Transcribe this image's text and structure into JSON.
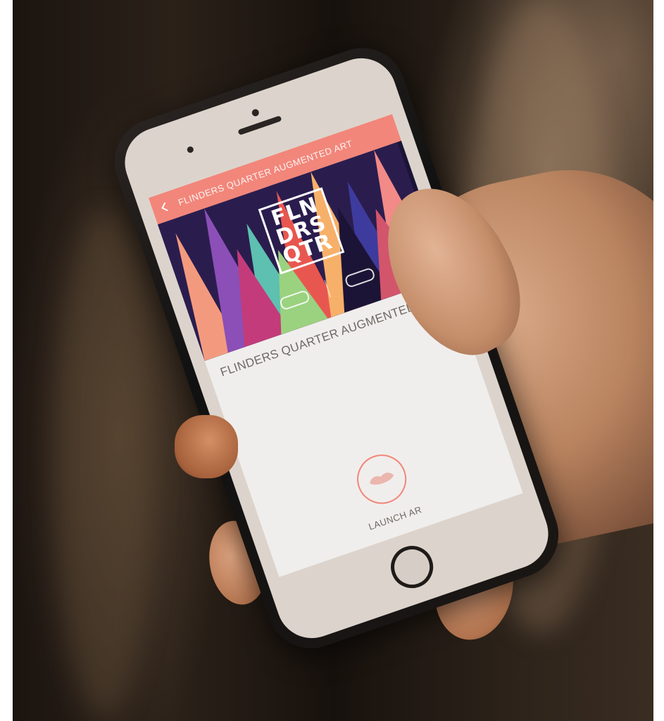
{
  "app": {
    "title": "FLINDERS QUARTER AUGMENTED ART"
  },
  "hero": {
    "logo_lines": [
      "FLN",
      "DRS",
      "QTR"
    ]
  },
  "event": {
    "title": "FLINDERS QUARTER AUGMENTED ART...",
    "dates": "",
    "paragraphs": [
      "",
      ""
    ]
  },
  "launch": {
    "label": "LAUNCH AR",
    "icon": "lips-icon"
  },
  "colors": {
    "accent": "#f2867a",
    "screen_bg": "#f0eeec",
    "text_primary": "#6e6964"
  }
}
